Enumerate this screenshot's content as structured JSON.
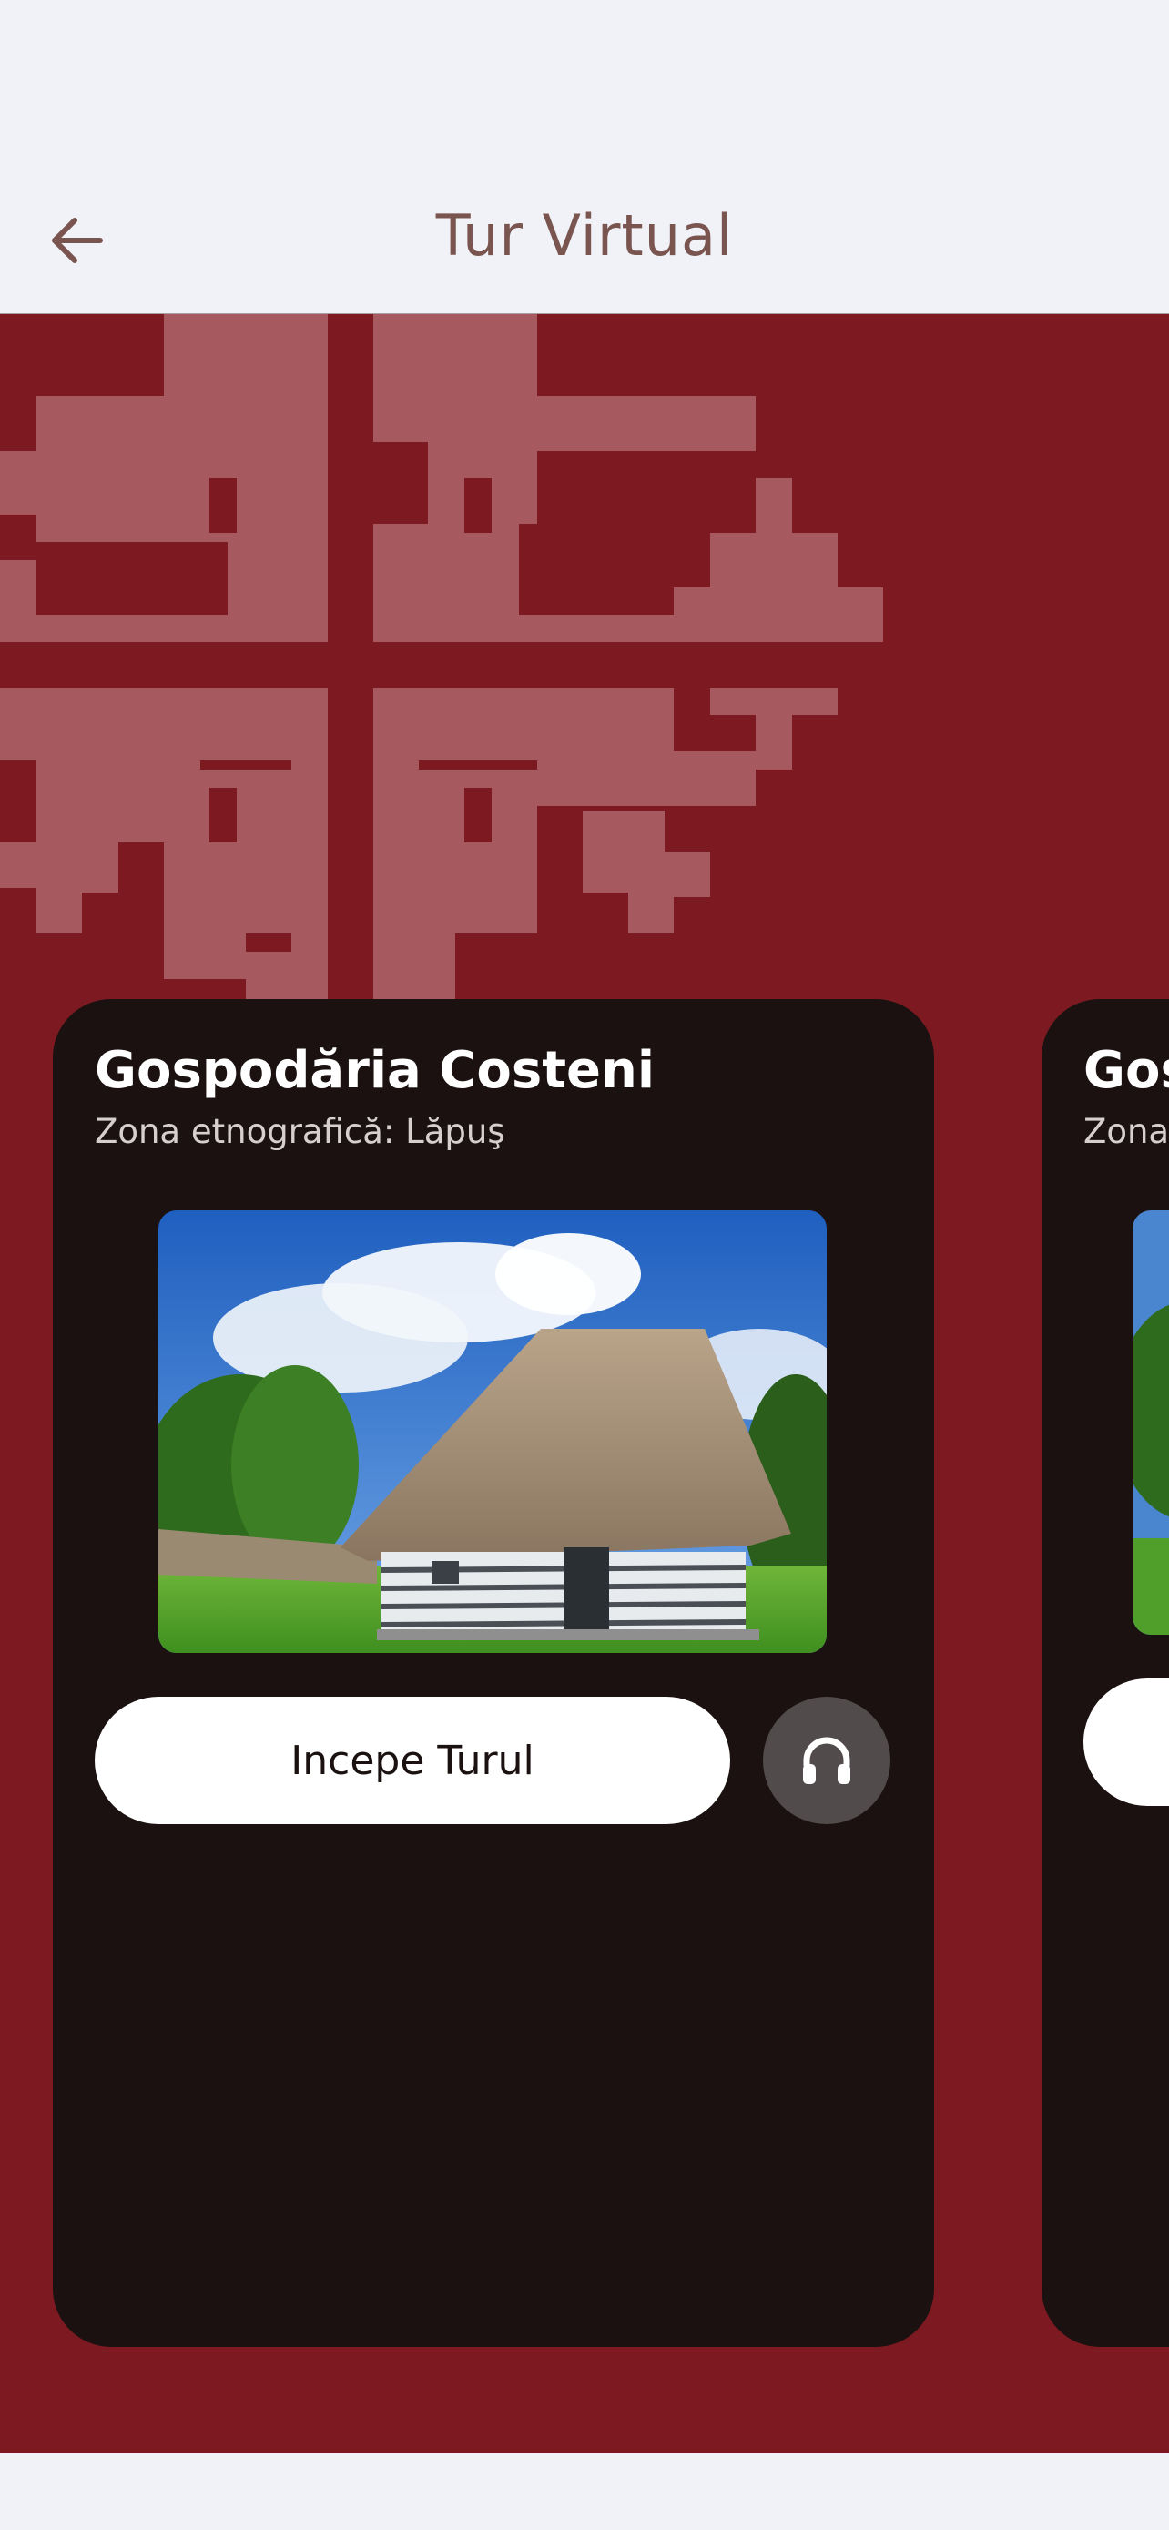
{
  "header": {
    "title": "Tur Virtual",
    "back_icon": "arrow-left-icon"
  },
  "colors": {
    "background": "#f0f2f7",
    "hero": "#7d1a21",
    "pattern": "#a65a60",
    "card": "#1b1111",
    "title_text": "#7a5550",
    "audio_button": "#514b4b"
  },
  "tours": [
    {
      "title": "Gospodăria Costeni",
      "subtitle": "Zona etnografică: Lăpuş",
      "start_label": "Incepe Turul",
      "audio_icon": "headphones-icon",
      "image": "thatched-roof-wooden-house-photo"
    },
    {
      "title": "Gos",
      "subtitle": "Zona",
      "start_label": "",
      "image": "house-photo-partial"
    }
  ]
}
